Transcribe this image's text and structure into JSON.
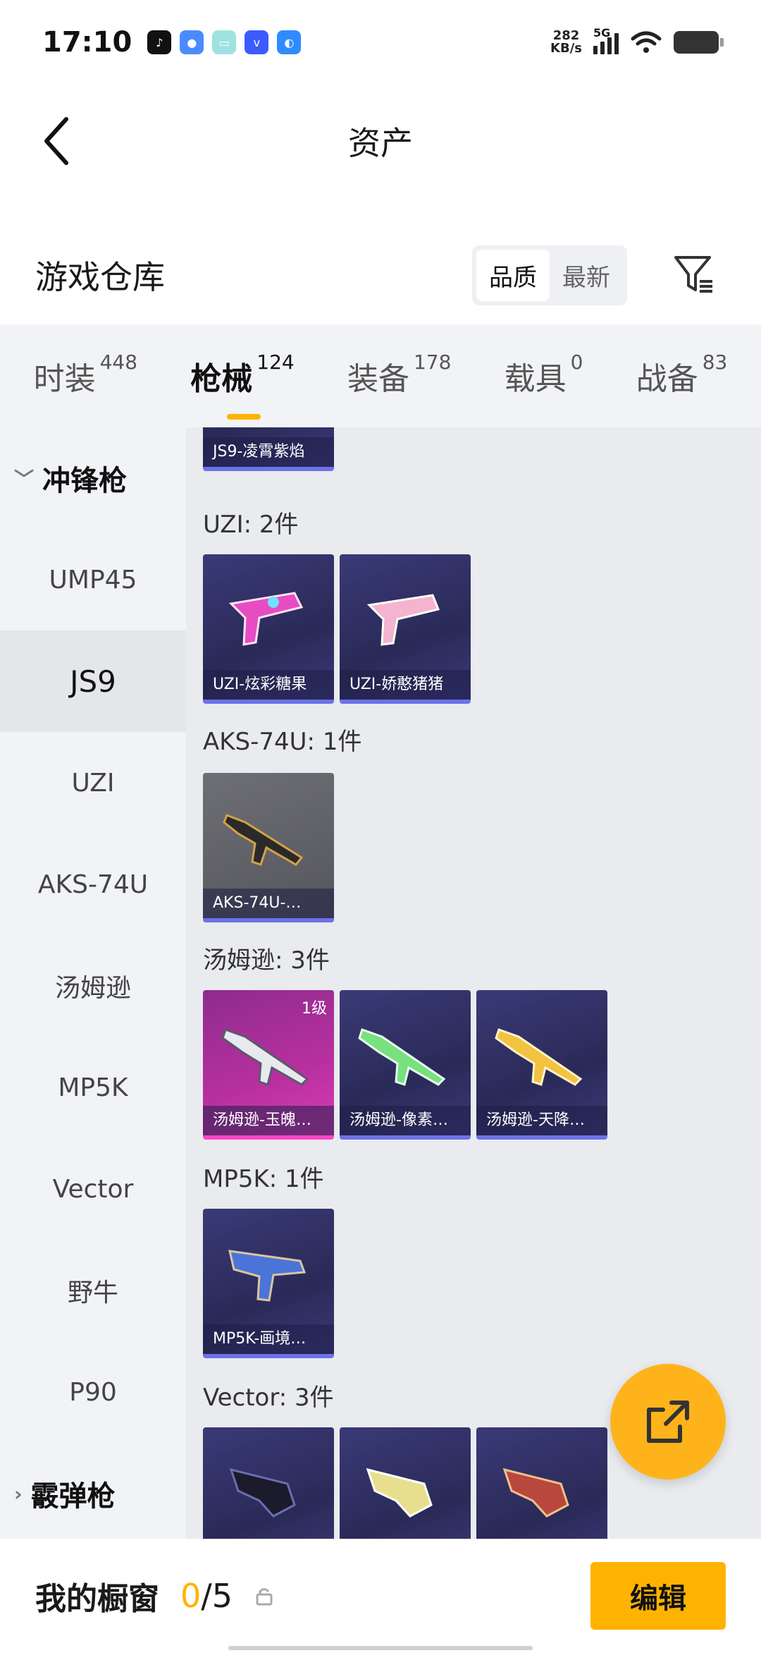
{
  "status_bar": {
    "time": "17:10",
    "net_speed_value": "282",
    "net_speed_unit": "KB/s",
    "network": "5G"
  },
  "header": {
    "title": "资产"
  },
  "warehouse": {
    "title": "游戏仓库",
    "sort_options": [
      "品质",
      "最新"
    ],
    "active_sort": "品质"
  },
  "tabs": [
    {
      "label": "时装",
      "count": "448"
    },
    {
      "label": "枪械",
      "count": "124"
    },
    {
      "label": "装备",
      "count": "178"
    },
    {
      "label": "载具",
      "count": "0"
    },
    {
      "label": "战备",
      "count": "83"
    }
  ],
  "sidebar": {
    "group_smg": "冲锋枪",
    "items": [
      "UMP45",
      "JS9",
      "UZI",
      "AKS-74U",
      "汤姆逊",
      "MP5K",
      "Vector",
      "野牛",
      "P90"
    ],
    "active_item": "JS9",
    "group_shotgun": "霰弹枪"
  },
  "content": {
    "partial_card": "JS9-凌霄紫焰",
    "sections": [
      {
        "heading": "UZI: 2件",
        "items": [
          "UZI-炫彩糖果",
          "UZI-娇憨猪猪"
        ]
      },
      {
        "heading": "AKS-74U: 1件",
        "items": [
          "AKS-74U-…"
        ]
      },
      {
        "heading": "汤姆逊: 3件",
        "items": [
          "汤姆逊-玉魄…",
          "汤姆逊-像素…",
          "汤姆逊-天降…"
        ],
        "first_item_level": "1级"
      },
      {
        "heading": "MP5K: 1件",
        "items": [
          "MP5K-画境…"
        ]
      },
      {
        "heading": "Vector: 3件"
      }
    ]
  },
  "bottom": {
    "showcase_label": "我的橱窗",
    "showcase_current": "0",
    "showcase_total": "/5",
    "edit_label": "编辑"
  },
  "colors": {
    "accent": "#ffb300",
    "card_purple": "#2e2e62",
    "card_pink": "#c0349f"
  }
}
